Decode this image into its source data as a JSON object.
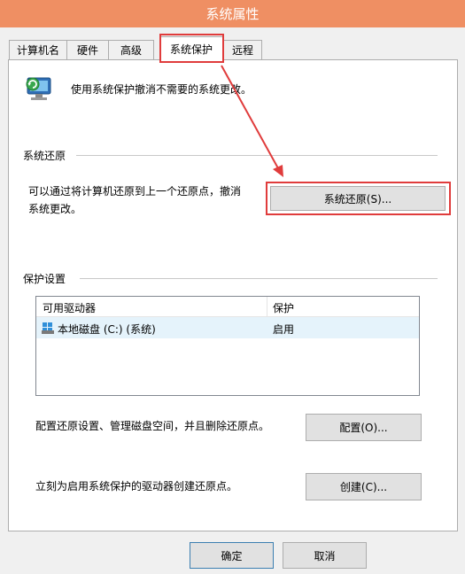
{
  "window": {
    "title": "系统属性"
  },
  "tabs": [
    {
      "label": "计算机名"
    },
    {
      "label": "硬件"
    },
    {
      "label": "高级"
    },
    {
      "label": "系统保护"
    },
    {
      "label": "远程"
    }
  ],
  "intro": {
    "text": "使用系统保护撤消不需要的系统更改。"
  },
  "restore_group": {
    "title": "系统还原",
    "description_line1": "可以通过将计算机还原到上一个还原点，撤消",
    "description_line2": "系统更改。",
    "button_label": "系统还原(S)..."
  },
  "protection_group": {
    "title": "保护设置",
    "columns": [
      "可用驱动器",
      "保护"
    ],
    "rows": [
      {
        "drive": "本地磁盘 (C:) (系统)",
        "protection": "启用"
      }
    ],
    "configure_text": "配置还原设置、管理磁盘空间，并且删除还原点。",
    "configure_button": "配置(O)...",
    "create_text": "立刻为启用系统保护的驱动器创建还原点。",
    "create_button": "创建(C)..."
  },
  "footer": {
    "ok_label": "确定",
    "cancel_label": "取消"
  },
  "colors": {
    "titlebar": "#ef8f63",
    "highlight_red": "#e03c3c",
    "selected_row": "#e5f3fb"
  }
}
